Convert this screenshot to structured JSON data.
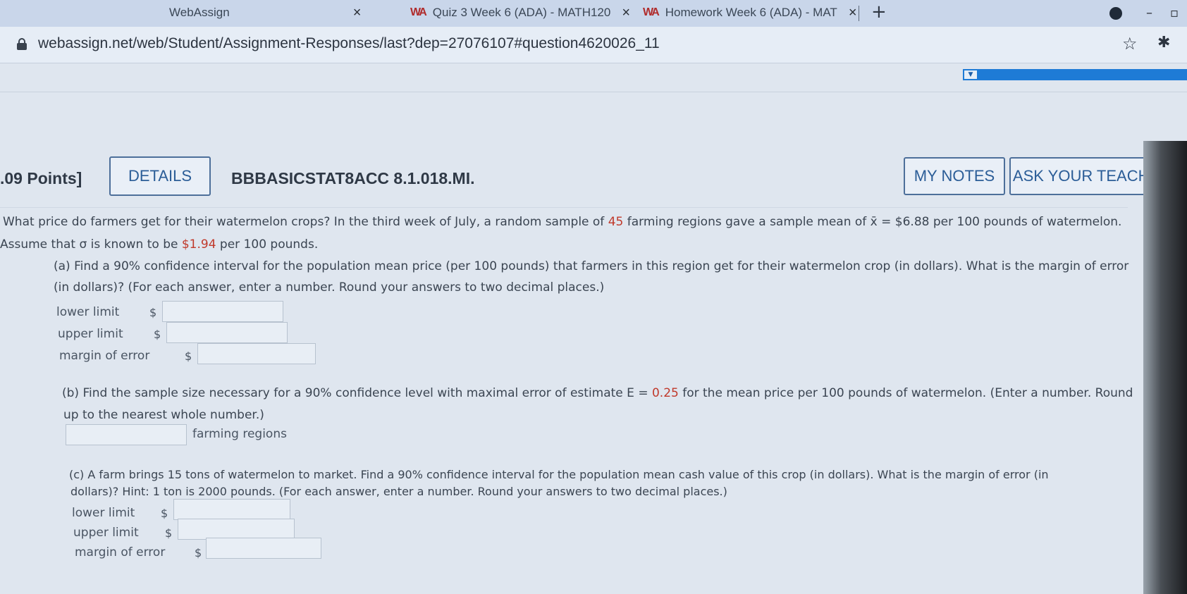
{
  "browser": {
    "tabs": [
      {
        "label": "WebAssign",
        "close": "×"
      },
      {
        "label": "Quiz 3 Week 6 (ADA) - MATH120",
        "close": "×"
      },
      {
        "label": "Homework Week 6 (ADA) - MAT",
        "close": "×"
      }
    ],
    "new_tab": "+",
    "url": "webassign.net/web/Student/Assignment-Responses/last?dep=27076107#question4620026_11"
  },
  "question": {
    "points": ".09 Points]",
    "details_label": "DETAILS",
    "code": "BBBASICSTAT8ACC 8.1.018.MI.",
    "my_notes_label": "MY NOTES",
    "ask_teacher_label": "ASK YOUR TEACHER",
    "intro_line1_a": "What price do farmers get for their watermelon crops? In the third week of July, a random sample of ",
    "intro_n": "45",
    "intro_line1_b": " farming regions gave a sample mean of x̄ = $6.88 per 100 pounds of watermelon.",
    "intro_line2_a": "Assume that σ is known to be ",
    "intro_sigma": "$1.94",
    "intro_line2_b": " per 100 pounds.",
    "part_a_line1": "(a) Find a 90% confidence interval for the population mean price (per 100 pounds) that farmers in this region get for their watermelon crop (in dollars). What is the margin of error",
    "part_a_line2": "(in dollars)? (For each answer, enter a number. Round your answers to two decimal places.)",
    "part_b_line1_a": "(b) Find the sample size necessary for a 90% confidence level with maximal error of estimate E = ",
    "part_b_E": "0.25",
    "part_b_line1_b": " for the mean price per 100 pounds of watermelon. (Enter a number. Round",
    "part_b_line2": "up to the nearest whole number.)",
    "part_b_unit": "farming regions",
    "part_c_line1": "(c) A farm brings 15 tons of watermelon to market. Find a 90% confidence interval for the population mean cash value of this crop (in dollars). What is the margin of error (in",
    "part_c_line2": "dollars)? Hint: 1 ton is 2000 pounds. (For each answer, enter a number. Round your answers to two decimal places.)",
    "labels": {
      "lower": "lower limit",
      "upper": "upper limit",
      "moe": "margin of error",
      "dollar": "$"
    }
  }
}
